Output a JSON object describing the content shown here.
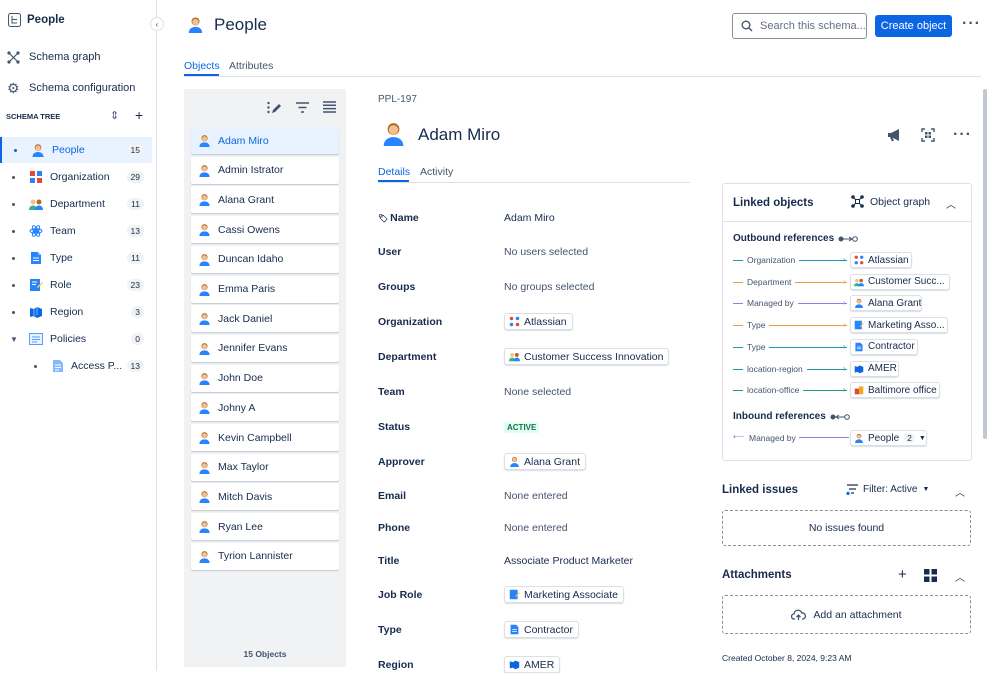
{
  "sidebar": {
    "project_title": "People",
    "nav": [
      {
        "label": "Schema graph",
        "icon": "schema-graph-icon"
      },
      {
        "label": "Schema configuration",
        "icon": "gear-icon"
      }
    ],
    "tree_heading": "SCHEMA TREE",
    "tree": [
      {
        "label": "People",
        "count": "15",
        "icon": "person-icon"
      },
      {
        "label": "Organization",
        "count": "29",
        "icon": "organization-icon"
      },
      {
        "label": "Department",
        "count": "11",
        "icon": "department-icon"
      },
      {
        "label": "Team",
        "count": "13",
        "icon": "team-icon"
      },
      {
        "label": "Type",
        "count": "11",
        "icon": "type-icon"
      },
      {
        "label": "Role",
        "count": "23",
        "icon": "role-icon"
      },
      {
        "label": "Region",
        "count": "3",
        "icon": "region-icon"
      },
      {
        "label": "Policies",
        "count": "0",
        "icon": "policies-icon"
      },
      {
        "label": "Access P...",
        "count": "13",
        "icon": "document-icon"
      }
    ]
  },
  "header": {
    "title": "People",
    "search_placeholder": "Search this schema...",
    "create_label": "Create object",
    "tabs": [
      "Objects",
      "Attributes"
    ]
  },
  "objects": {
    "items": [
      "Adam Miro",
      "Admin Istrator",
      "Alana Grant",
      "Cassi Owens",
      "Duncan Idaho",
      "Emma Paris",
      "Jack Daniel",
      "Jennifer Evans",
      "John Doe",
      "Johny A",
      "Kevin Campbell",
      "Max Taylor",
      "Mitch Davis",
      "Ryan Lee",
      "Tyrion Lannister"
    ],
    "footer": "15 Objects"
  },
  "detail": {
    "key": "PPL-197",
    "name": "Adam Miro",
    "tabs": [
      "Details",
      "Activity"
    ],
    "attributes": {
      "name_label": "Name",
      "name_value": "Adam Miro",
      "user_label": "User",
      "user_value": "No users selected",
      "groups_label": "Groups",
      "groups_value": "No groups selected",
      "org_label": "Organization",
      "org_value": "Atlassian",
      "dept_label": "Department",
      "dept_value": "Customer Success Innovation",
      "team_label": "Team",
      "team_value": "None selected",
      "status_label": "Status",
      "status_value": "ACTIVE",
      "approver_label": "Approver",
      "approver_value": "Alana Grant",
      "email_label": "Email",
      "email_value": "None entered",
      "phone_label": "Phone",
      "phone_value": "None entered",
      "title_label": "Title",
      "title_value": "Associate Product Marketer",
      "jobrole_label": "Job Role",
      "jobrole_value": "Marketing Associate",
      "type_label": "Type",
      "type_value": "Contractor",
      "region_label": "Region",
      "region_value": "AMER"
    }
  },
  "linked": {
    "title": "Linked objects",
    "graph_label": "Object graph",
    "outbound_title": "Outbound references",
    "outbound": [
      {
        "label": "Organization",
        "value": "Atlassian"
      },
      {
        "label": "Department",
        "value": "Customer Succ..."
      },
      {
        "label": "Managed by",
        "value": "Alana Grant"
      },
      {
        "label": "Type",
        "value": "Marketing Asso..."
      },
      {
        "label": "Type",
        "value": "Contractor"
      },
      {
        "label": "location-region",
        "value": "AMER"
      },
      {
        "label": "location-office",
        "value": "Baltimore office"
      }
    ],
    "inbound_title": "Inbound references",
    "inbound": {
      "label": "Managed by",
      "value": "People",
      "count": "2"
    },
    "colors": {
      "teal": "#1d9aaa",
      "orange": "#e2a03f",
      "purple": "#8f7ee7",
      "green": "#22a06b"
    }
  },
  "issues": {
    "title": "Linked issues",
    "filter": "Filter: Active",
    "empty": "No issues found"
  },
  "attachments": {
    "title": "Attachments",
    "add": "Add an attachment",
    "created": "Created October 8, 2024, 9:23 AM"
  }
}
